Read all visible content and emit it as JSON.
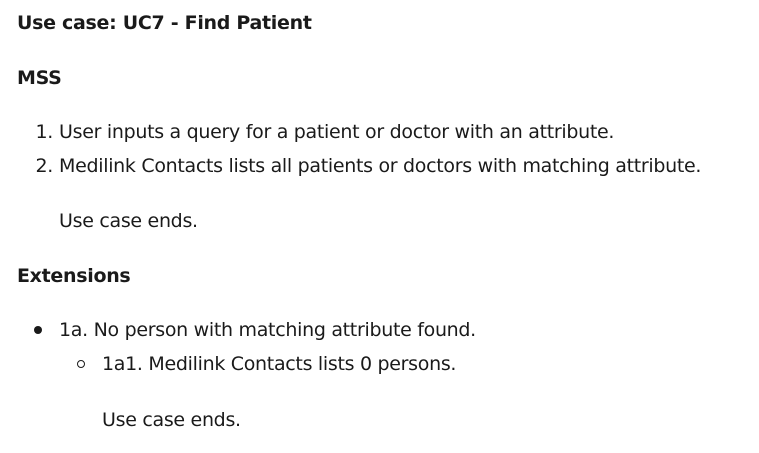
{
  "title": "Use case: UC7 - Find Patient",
  "mss": {
    "heading": "MSS",
    "steps": [
      {
        "number": "1.",
        "text": "User inputs a query for a patient or doctor with an attribute."
      },
      {
        "number": "2.",
        "text": "Medilink Contacts lists all patients or doctors with matching attribute."
      }
    ],
    "end_text": "Use case ends."
  },
  "extensions": {
    "heading": "Extensions",
    "items": [
      {
        "text": "1a. No person with matching attribute found.",
        "sub_items": [
          {
            "text": "1a1. Medilink Contacts lists 0 persons."
          }
        ],
        "end_text": "Use case ends."
      }
    ]
  }
}
